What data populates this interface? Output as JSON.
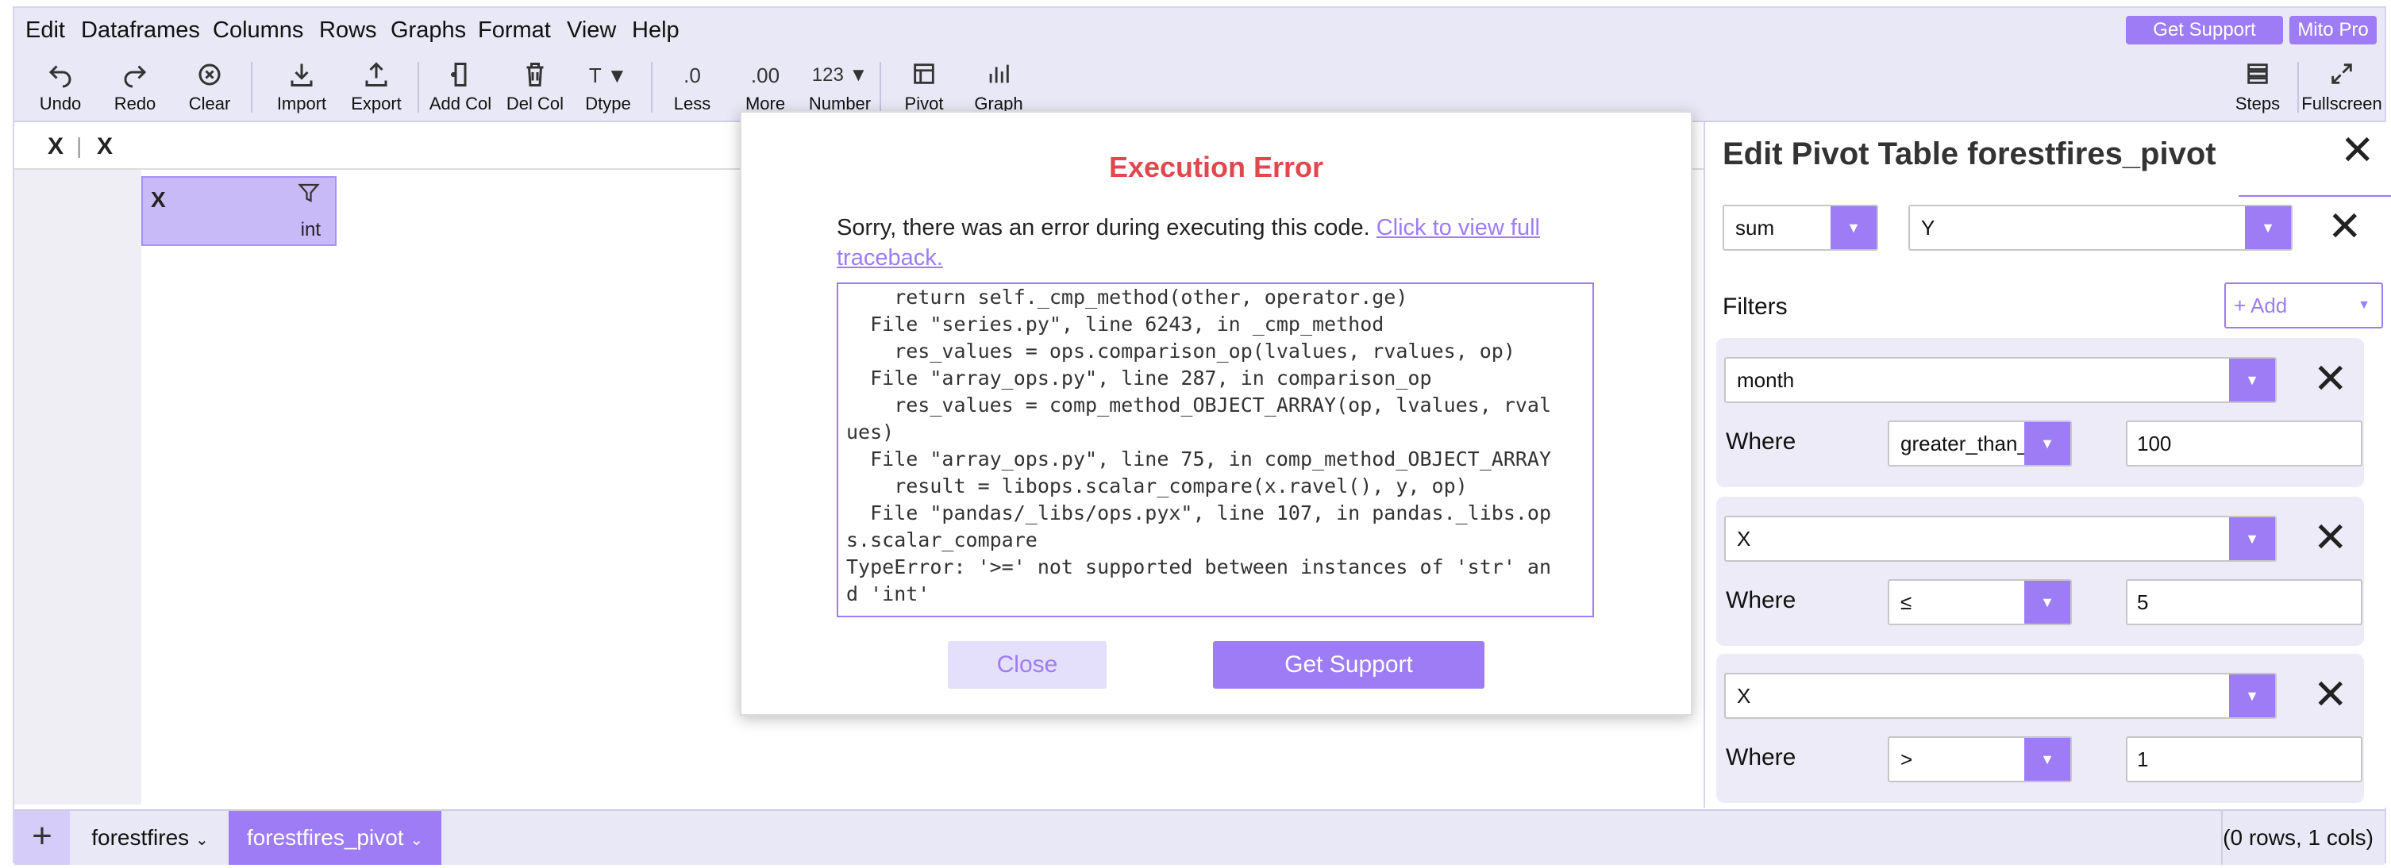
{
  "menu": [
    "Edit",
    "Dataframes",
    "Columns",
    "Rows",
    "Graphs",
    "Format",
    "View",
    "Help"
  ],
  "top_buttons": {
    "get_support": "Get Support",
    "mito_pro": "Mito Pro"
  },
  "toolbar": {
    "undo": "Undo",
    "redo": "Redo",
    "clear": "Clear",
    "import": "Import",
    "export": "Export",
    "add_col": "Add Col",
    "del_col": "Del Col",
    "dtype": "Dtype",
    "less": "Less",
    "more": "More",
    "number": "Number",
    "pivot": "Pivot",
    "graph": "Graph",
    "steps": "Steps",
    "fullscreen": "Fullscreen",
    "dtype_icon": "T ▼",
    "less_icon": ".0",
    "more_icon": ".00",
    "number_icon": "123 ▼"
  },
  "formula_bar": {
    "cell": "X",
    "value": "X"
  },
  "column": {
    "name": "X",
    "dtype": "int"
  },
  "modal": {
    "title": "Execution Error",
    "message": "Sorry, there was an error during executing this code.",
    "link_line1": "Click to view full",
    "link_line2": "traceback.",
    "traceback": "    return self._cmp_method(other, operator.ge)\n  File \"series.py\", line 6243, in _cmp_method\n    res_values = ops.comparison_op(lvalues, rvalues, op)\n  File \"array_ops.py\", line 287, in comparison_op\n    res_values = comp_method_OBJECT_ARRAY(op, lvalues, rval\nues)\n  File \"array_ops.py\", line 75, in comp_method_OBJECT_ARRAY\n    result = libops.scalar_compare(x.ravel(), y, op)\n  File \"pandas/_libs/ops.pyx\", line 107, in pandas._libs.op\ns.scalar_compare\nTypeError: '>=' not supported between instances of 'str' an\nd 'int'",
    "close": "Close",
    "get_support": "Get Support"
  },
  "panel": {
    "title": "Edit Pivot Table forestfires_pivot",
    "agg_func": "sum",
    "agg_column": "Y",
    "filters_label": "Filters",
    "add_label": "+ Add",
    "where_label": "Where",
    "filters": [
      {
        "column": "month",
        "condition": "greater_than_o",
        "value": "100"
      },
      {
        "column": "X",
        "condition": "≤",
        "value": "5"
      },
      {
        "column": "X",
        "condition": ">",
        "value": "1"
      }
    ]
  },
  "footer": {
    "sheets": [
      "forestfires",
      "forestfires_pivot"
    ],
    "status": "(0 rows, 1 cols)"
  },
  "colors": {
    "accent": "#9d7cf5",
    "error": "#e0484e",
    "toolbar_bg": "#e9e8f6"
  }
}
